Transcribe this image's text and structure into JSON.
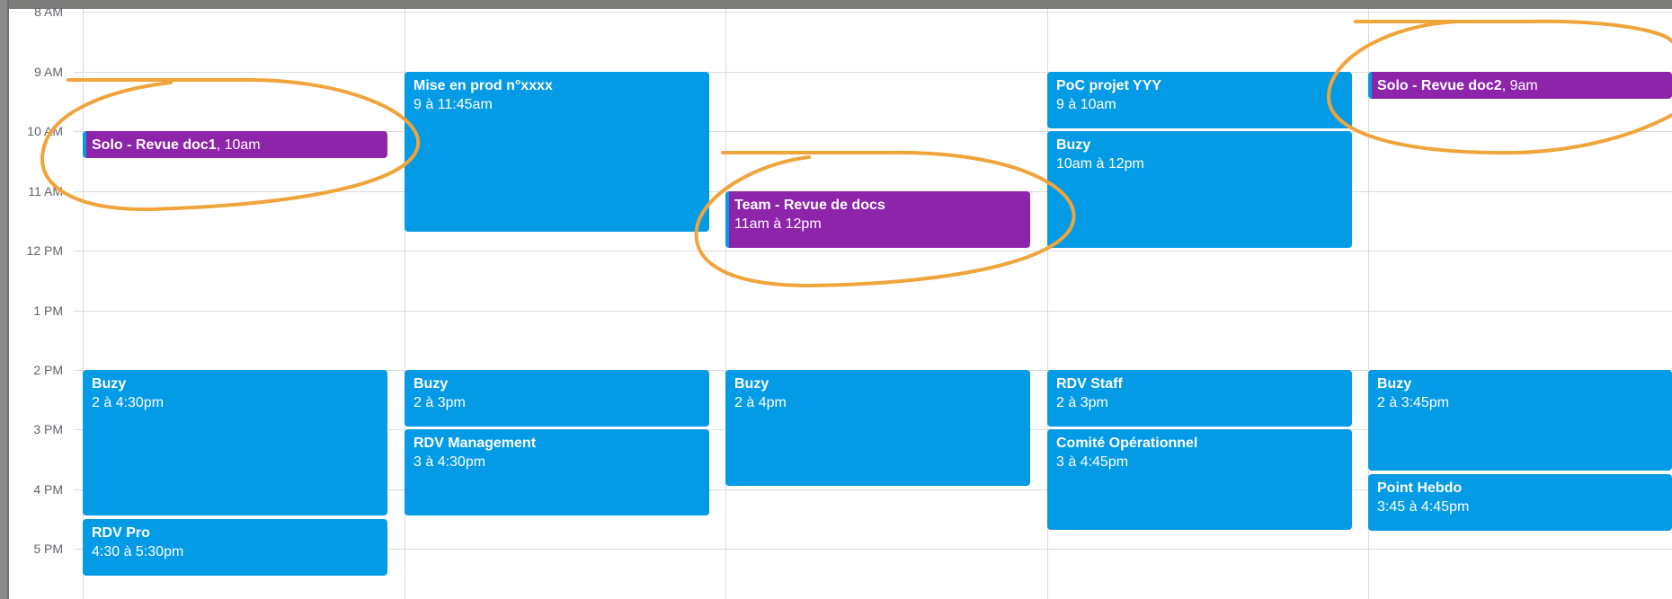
{
  "hours": [
    "8 AM",
    "9 AM",
    "10 AM",
    "11 AM",
    "12 PM",
    "1 PM",
    "2 PM",
    "3 PM",
    "4 PM",
    "5 PM"
  ],
  "colors": {
    "event_blue": "#039be5",
    "event_purple": "#8e24aa",
    "annotation_orange": "#f0a43a"
  },
  "days": [
    {
      "events": [
        {
          "title": "Solo - Revue doc1",
          "time": ", 10am",
          "color": "purple"
        },
        {
          "title": "Buzy",
          "time": "2 à 4:30pm",
          "color": "blue"
        },
        {
          "title": "RDV Pro",
          "time": "4:30 à 5:30pm",
          "color": "blue"
        }
      ]
    },
    {
      "events": [
        {
          "title": "Mise en prod n°xxxx",
          "time": "9 à 11:45am",
          "color": "blue"
        },
        {
          "title": "Buzy",
          "time": "2 à 3pm",
          "color": "blue"
        },
        {
          "title": "RDV Management",
          "time": "3 à 4:30pm",
          "color": "blue"
        }
      ]
    },
    {
      "events": [
        {
          "title": "Team - Revue de docs",
          "time": "11am à 12pm",
          "color": "purple"
        },
        {
          "title": "Buzy",
          "time": "2 à 4pm",
          "color": "blue"
        }
      ]
    },
    {
      "events": [
        {
          "title": "PoC projet YYY",
          "time": "9 à 10am",
          "color": "blue"
        },
        {
          "title": "Buzy",
          "time": "10am à 12pm",
          "color": "blue"
        },
        {
          "title": "RDV Staff",
          "time": "2 à 3pm",
          "color": "blue"
        },
        {
          "title": "Comité Opérationnel",
          "time": "3 à 4:45pm",
          "color": "blue"
        }
      ]
    },
    {
      "events": [
        {
          "title": "Solo - Revue doc2",
          "time": ", 9am",
          "color": "purple"
        },
        {
          "title": "Buzy",
          "time": "2 à 3:45pm",
          "color": "blue"
        },
        {
          "title": "Point Hebdo",
          "time": "3:45 à 4:45pm",
          "color": "blue"
        }
      ]
    }
  ]
}
